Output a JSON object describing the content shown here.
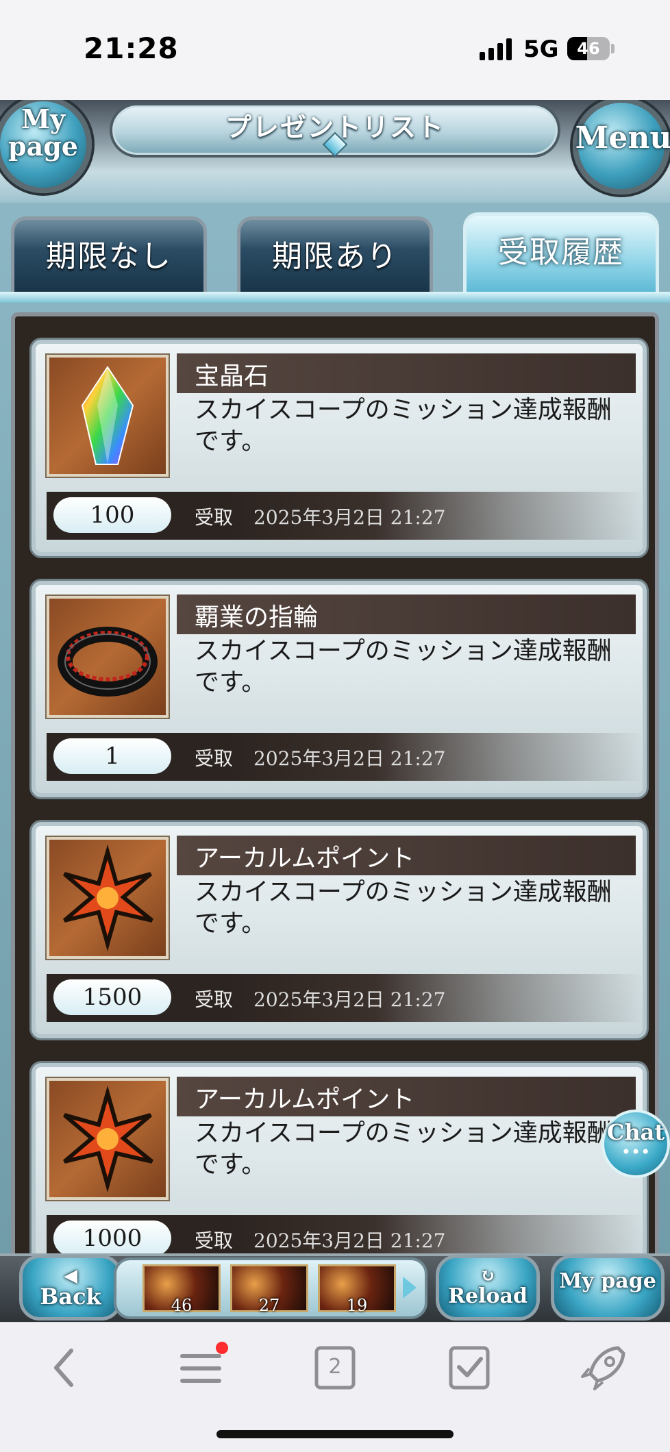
{
  "status_bar": {
    "time": "21:28",
    "network": "5G",
    "battery": "46",
    "battery_level": 0.46
  },
  "header": {
    "title": "プレゼントリスト",
    "mypage_button": "My page",
    "menu_button": "Menu"
  },
  "tabs": [
    {
      "label": "期限なし",
      "active": false
    },
    {
      "label": "期限あり",
      "active": false
    },
    {
      "label": "受取履歴",
      "active": true
    }
  ],
  "items": [
    {
      "name": "宝晶石",
      "description": "スカイスコープのミッション達成報酬です。",
      "quantity": "100",
      "received_label": "受取",
      "date": "2025年3月2日 21:27",
      "icon": "crystal-icon"
    },
    {
      "name": "覇業の指輪",
      "description": "スカイスコープのミッション達成報酬です。",
      "quantity": "1",
      "received_label": "受取",
      "date": "2025年3月2日 21:27",
      "icon": "ring-icon"
    },
    {
      "name": "アーカルムポイント",
      "description": "スカイスコープのミッション達成報酬です。",
      "quantity": "1500",
      "received_label": "受取",
      "date": "2025年3月2日 21:27",
      "icon": "arcarum-point-icon"
    },
    {
      "name": "アーカルムポイント",
      "description": "スカイスコープのミッション達成報酬です。",
      "quantity": "1000",
      "received_label": "受取",
      "date": "2025年3月2日 21:27",
      "icon": "arcarum-point-icon"
    }
  ],
  "chat_button": "Chat",
  "bottom_bar": {
    "back": "Back",
    "reload": "Reload",
    "mypage": "My page",
    "quick_slots": [
      {
        "count": "46"
      },
      {
        "count": "27"
      },
      {
        "count": "19"
      }
    ]
  },
  "browser_toolbar": {
    "tab_count": "2",
    "icons": [
      "back-arrow-icon",
      "menu-icon",
      "tabs-icon",
      "checkbox-icon",
      "rocket-icon"
    ]
  }
}
